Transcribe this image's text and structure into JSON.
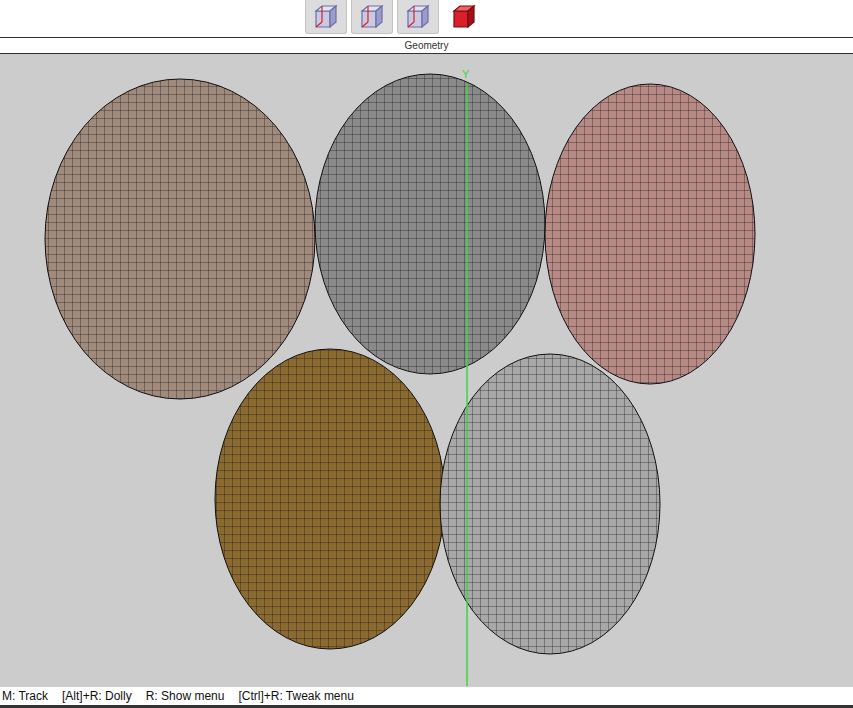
{
  "toolbar": {
    "buttons": [
      {
        "name": "wireframe-cube",
        "pressed": true,
        "color": "#6b6fa8"
      },
      {
        "name": "shaded-wire-cube",
        "pressed": true,
        "color": "#6b6fa8"
      },
      {
        "name": "half-shaded-cube",
        "pressed": true,
        "color": "#6b6fa8"
      },
      {
        "name": "solid-cube",
        "pressed": false,
        "color": "#d9202a"
      }
    ]
  },
  "panel": {
    "title": "Geometry"
  },
  "viewport": {
    "axis_label": "Y"
  },
  "status_bar": [
    "M: Track",
    "[Alt]+R: Dolly",
    "R: Show menu",
    "[Ctrl]+R: Tweak menu"
  ]
}
